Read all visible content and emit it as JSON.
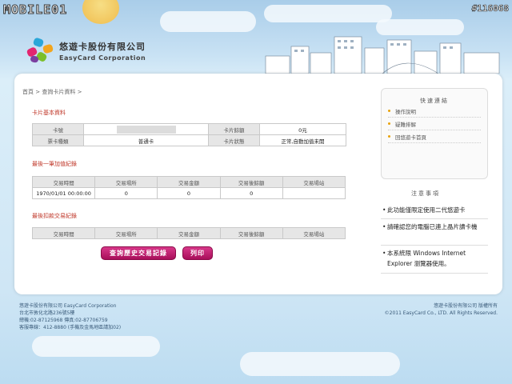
{
  "watermark": "#116068",
  "mobile_logo": "MOBILE01",
  "corp": {
    "name_zh": "悠遊卡股份有限公司",
    "name_en": "EasyCard Corporation"
  },
  "breadcrumb": {
    "home": "首頁",
    "sep1": ">",
    "page": "查詢卡片資料",
    "sep2": ">"
  },
  "card_info": {
    "section_title": "卡片基本資料",
    "labels": {
      "card_no": "卡號",
      "balance": "卡片餘額",
      "card_type": "票卡種類",
      "status": "卡片狀態"
    },
    "values": {
      "balance": "0元",
      "card_type": "普通卡",
      "status": "正常,自動加值未開"
    }
  },
  "last_topup": {
    "section_title": "最後一筆加值紀錄",
    "headers": [
      "交易時間",
      "交易場所",
      "交易金額",
      "交易後餘額",
      "交易場站"
    ],
    "rows": [
      [
        "1970/01/01 00:00:00",
        "0",
        "0",
        "0",
        ""
      ]
    ]
  },
  "last_deduct": {
    "section_title": "最後扣款交易紀錄",
    "headers": [
      "交易時間",
      "交易場所",
      "交易金額",
      "交易後餘額",
      "交易場站"
    ]
  },
  "buttons": {
    "history": "查詢歷史交易記錄",
    "print": "列印"
  },
  "quick_links": {
    "title": "快速連結",
    "items": [
      "操作說明",
      "疑難排解",
      "回悠遊卡首頁"
    ]
  },
  "notes": {
    "title": "注意事項",
    "items": [
      "此功能僅限定使用二代悠遊卡",
      "請確認您的電腦已連上晶片讀卡機",
      "本系統限 Windows Internet Explorer 瀏覽器使用。"
    ]
  },
  "footer": {
    "left": [
      "悠遊卡股份有限公司 EasyCard Corporation",
      "台北市敦化北路236號5樓",
      "總機:02-87125968 傳真:02-87706759",
      "客服專線：412-8880 (手機及金馬地區請加02)"
    ],
    "right": [
      "悠遊卡股份有限公司 版權所有",
      "©2011 EasyCard Co., LTD. All Rights Reserved."
    ]
  },
  "colors": {
    "accent_red": "#c0392b",
    "button_magenta": "#c2196d",
    "bullet_orange": "#e8a20a",
    "sky_blue": "#a9cde9"
  }
}
